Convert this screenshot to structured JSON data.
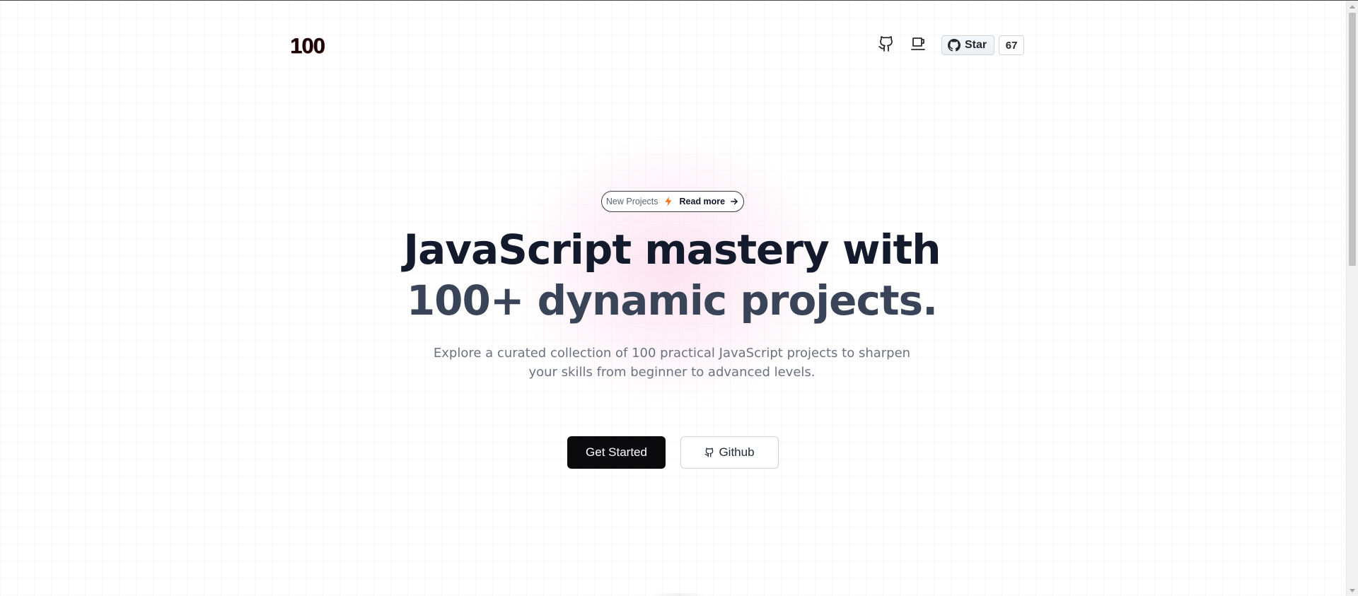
{
  "header": {
    "logo_text": "100",
    "github_icon": "github-icon",
    "coffee_icon": "coffee-cup-icon",
    "star_button": {
      "icon": "github-mark-icon",
      "label": "Star",
      "count": "67"
    }
  },
  "hero": {
    "announcement": {
      "new_label": "New Projects",
      "bolt_icon": "lightning-bolt-icon",
      "read_more_label": "Read more",
      "arrow_icon": "arrow-right-icon"
    },
    "headline_line1": "JavaScript mastery with",
    "headline_line2": "100+ dynamic projects.",
    "subtitle": "Explore a curated collection of 100 practical JavaScript projects to sharpen your skills from beginner to advanced levels.",
    "primary_button_label": "Get Started",
    "secondary_button_label": "Github",
    "secondary_button_icon": "github-icon"
  },
  "colors": {
    "accent_bolt": "#f97316",
    "primary_button_bg": "#0b0b0d",
    "headline_dark": "#131a2b",
    "headline_muted": "#3a4458",
    "subtitle_gray": "#6b7280"
  }
}
